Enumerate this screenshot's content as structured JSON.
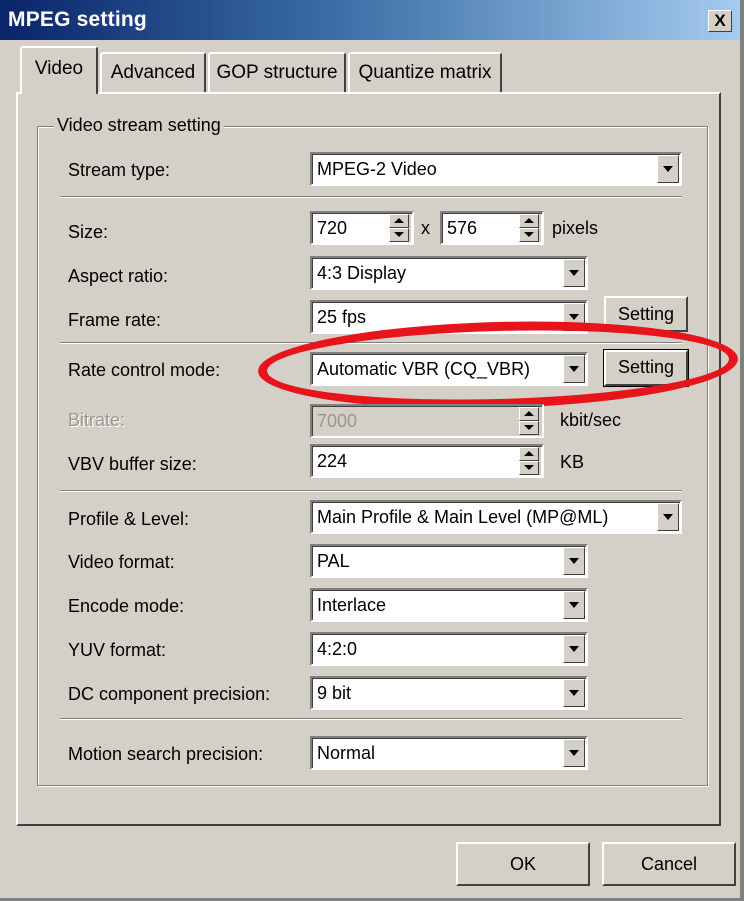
{
  "window": {
    "title": "MPEG setting",
    "close_label": "X"
  },
  "tabs": [
    {
      "label": "Video",
      "active": true
    },
    {
      "label": "Advanced",
      "active": false
    },
    {
      "label": "GOP structure",
      "active": false
    },
    {
      "label": "Quantize matrix",
      "active": false
    }
  ],
  "group_title": "Video stream setting",
  "fields": {
    "stream_type": {
      "label": "Stream type:",
      "value": "MPEG-2 Video"
    },
    "size": {
      "label": "Size:",
      "width": "720",
      "times": "x",
      "height": "576",
      "unit": "pixels"
    },
    "aspect_ratio": {
      "label": "Aspect ratio:",
      "value": "4:3 Display"
    },
    "frame_rate": {
      "label": "Frame rate:",
      "value": "25 fps",
      "button": "Setting"
    },
    "rate_control": {
      "label": "Rate control mode:",
      "value": "Automatic VBR (CQ_VBR)",
      "button": "Setting"
    },
    "bitrate": {
      "label": "Bitrate:",
      "value": "7000",
      "unit": "kbit/sec"
    },
    "vbv_buffer": {
      "label": "VBV buffer size:",
      "value": "224",
      "unit": "KB"
    },
    "profile_level": {
      "label": "Profile & Level:",
      "value": "Main Profile & Main Level (MP@ML)"
    },
    "video_format": {
      "label": "Video format:",
      "value": "PAL"
    },
    "encode_mode": {
      "label": "Encode mode:",
      "value": "Interlace"
    },
    "yuv_format": {
      "label": "YUV format:",
      "value": "4:2:0"
    },
    "dc_precision": {
      "label": "DC component precision:",
      "value": "9 bit"
    },
    "motion_search": {
      "label": "Motion search precision:",
      "value": "Normal"
    }
  },
  "buttons": {
    "ok": "OK",
    "cancel": "Cancel"
  },
  "colors": {
    "title_bar": "#0a246a",
    "face": "#d4d0c8",
    "highlight": "#e8141c"
  }
}
